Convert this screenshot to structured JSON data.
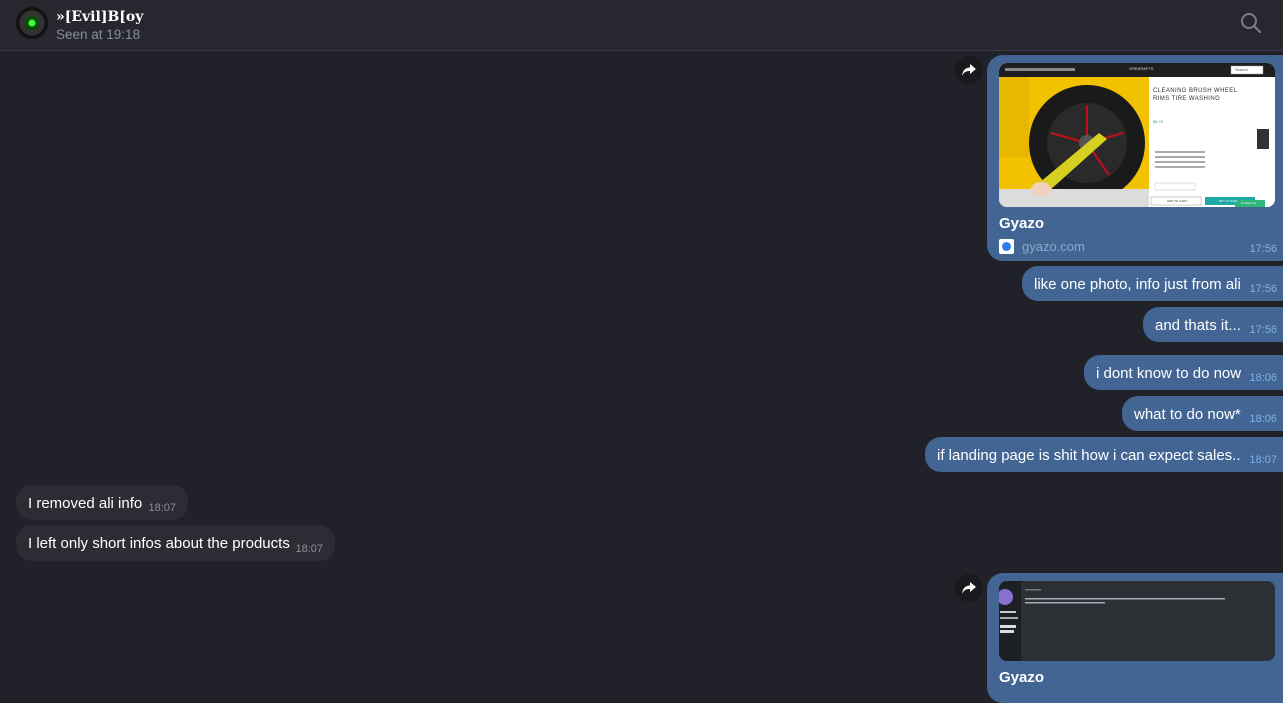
{
  "header": {
    "name": "»[Evil]B[oy",
    "status": "Seen at 19:18"
  },
  "forward_icon": "share-arrow-icon",
  "search_icon": "search-icon",
  "outgoing_color": "#436593",
  "incoming_color": "#2c2c34",
  "messages": {
    "card1": {
      "title": "Gyazo",
      "site": "gyazo.com",
      "time": "17:56"
    },
    "m1": {
      "text": "like one photo, info just from ali",
      "time": "17:56"
    },
    "m2": {
      "text": "and thats it...",
      "time": "17:56"
    },
    "m3": {
      "text": "i dont know to do now",
      "time": "18:06"
    },
    "m4": {
      "text": "what to do now*",
      "time": "18:06"
    },
    "m5": {
      "text": "if landing page is shit how i can expect sales..",
      "time": "18:07"
    },
    "in1": {
      "text": "I removed ali info",
      "time": "18:07"
    },
    "in2": {
      "text": "I left only short infos about the products",
      "time": "18:07"
    },
    "card2": {
      "title": "Gyazo"
    }
  },
  "preview1": {
    "brand": "OREKRAFTS",
    "search_placeholder": "Search",
    "product_title": "CLEANING BRUSH WHEEL RIMS TIRE WASHING",
    "price": "$6.75",
    "add_to_cart": "ADD TO CART",
    "buy_now": "BUY IT NOW",
    "contact": "Contact Us"
  }
}
